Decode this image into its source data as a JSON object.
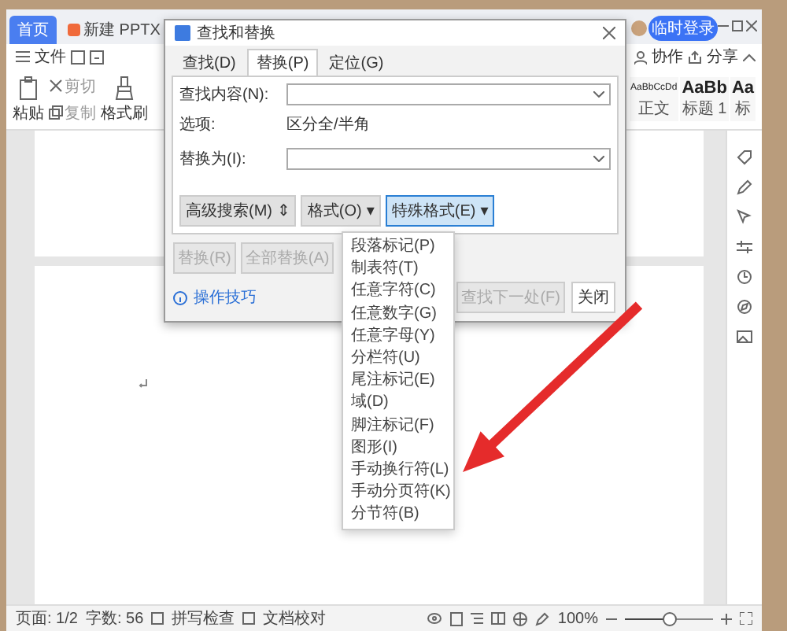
{
  "tabs": [
    {
      "label": "首页",
      "selected": true
    },
    {
      "label": "新建 PPTX",
      "selected": false
    }
  ],
  "account": {
    "login": "临时登录"
  },
  "toolbar": {
    "file_menu": "文件",
    "collab": "协作",
    "share": "分享"
  },
  "ribbon": {
    "tools": [
      {
        "kind": "paste",
        "label": "粘贴"
      },
      {
        "kind": "cut",
        "label": "剪切"
      },
      {
        "kind": "copy",
        "label": "复制"
      },
      {
        "kind": "brush",
        "label": "格式刷"
      }
    ],
    "styles": [
      {
        "preview": "AaBbCcDd",
        "name": "正文"
      },
      {
        "preview": "AaBb",
        "name": "标题 1"
      },
      {
        "preview": "Aa",
        "name": "标"
      }
    ]
  },
  "dialog": {
    "title": "查找和替换",
    "tabs": [
      {
        "label": "查找(D)",
        "selected": false
      },
      {
        "label": "替换(P)",
        "selected": true
      },
      {
        "label": "定位(G)",
        "selected": false
      }
    ],
    "find_label": "查找内容(N):",
    "options_label": "选项:",
    "options_value": "区分全/半角",
    "replace_label": "替换为(I):",
    "format_buttons": [
      {
        "label": "高级搜索(M)",
        "caret": "⇕",
        "expanded": false
      },
      {
        "label": "格式(O)",
        "caret": "▾",
        "expanded": false
      },
      {
        "label": "特殊格式(E)",
        "caret": "▾",
        "expanded": true
      }
    ],
    "action_buttons": [
      {
        "label": "替换(R)",
        "disabled": true
      },
      {
        "label": "全部替换(A)",
        "disabled": true
      }
    ],
    "tips_link": "操作技巧",
    "footer_buttons": [
      {
        "label": "查找下一处(F)",
        "disabled": true
      },
      {
        "label": "关闭",
        "disabled": false
      }
    ]
  },
  "special_menu": [
    "段落标记(P)",
    "制表符(T)",
    "任意字符(C)",
    "任意数字(G)",
    "任意字母(Y)",
    "分栏符(U)",
    "尾注标记(E)",
    "域(D)",
    "脚注标记(F)",
    "图形(I)",
    "手动换行符(L)",
    "手动分页符(K)",
    "分节符(B)"
  ],
  "status_bar": {
    "page": "页面: 1/2",
    "words": "字数: 56",
    "spell_check": "拼写检查",
    "proofread": "文档校对",
    "zoom": "100%",
    "zoom_level": {
      "level": 0.5
    }
  }
}
